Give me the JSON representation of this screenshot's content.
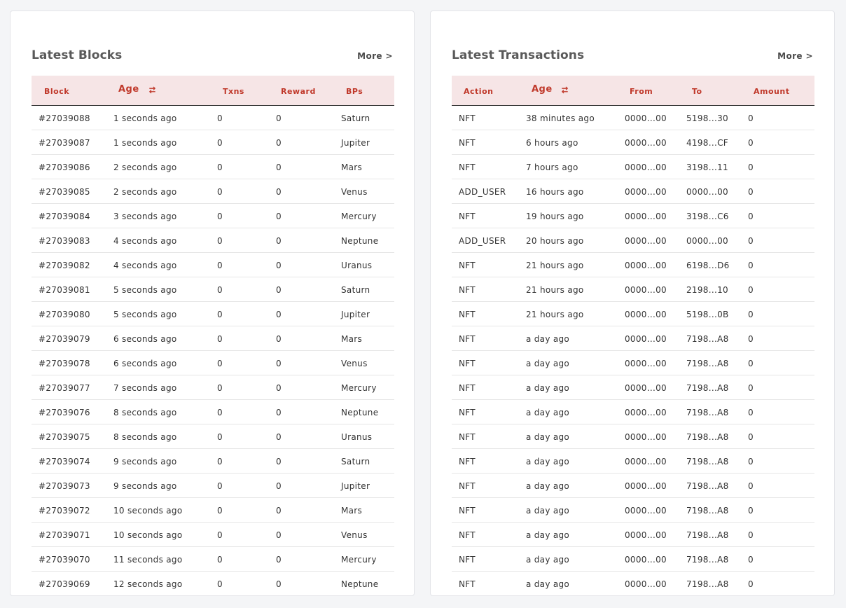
{
  "blocks": {
    "title": "Latest Blocks",
    "more": "More >",
    "columns": [
      "Block",
      "Age",
      "Txns",
      "Reward",
      "BPs"
    ],
    "rows": [
      [
        "#27039088",
        "1 seconds ago",
        "0",
        "0",
        "Saturn"
      ],
      [
        "#27039087",
        "1 seconds ago",
        "0",
        "0",
        "Jupiter"
      ],
      [
        "#27039086",
        "2 seconds ago",
        "0",
        "0",
        "Mars"
      ],
      [
        "#27039085",
        "2 seconds ago",
        "0",
        "0",
        "Venus"
      ],
      [
        "#27039084",
        "3 seconds ago",
        "0",
        "0",
        "Mercury"
      ],
      [
        "#27039083",
        "4 seconds ago",
        "0",
        "0",
        "Neptune"
      ],
      [
        "#27039082",
        "4 seconds ago",
        "0",
        "0",
        "Uranus"
      ],
      [
        "#27039081",
        "5 seconds ago",
        "0",
        "0",
        "Saturn"
      ],
      [
        "#27039080",
        "5 seconds ago",
        "0",
        "0",
        "Jupiter"
      ],
      [
        "#27039079",
        "6 seconds ago",
        "0",
        "0",
        "Mars"
      ],
      [
        "#27039078",
        "6 seconds ago",
        "0",
        "0",
        "Venus"
      ],
      [
        "#27039077",
        "7 seconds ago",
        "0",
        "0",
        "Mercury"
      ],
      [
        "#27039076",
        "8 seconds ago",
        "0",
        "0",
        "Neptune"
      ],
      [
        "#27039075",
        "8 seconds ago",
        "0",
        "0",
        "Uranus"
      ],
      [
        "#27039074",
        "9 seconds ago",
        "0",
        "0",
        "Saturn"
      ],
      [
        "#27039073",
        "9 seconds ago",
        "0",
        "0",
        "Jupiter"
      ],
      [
        "#27039072",
        "10 seconds ago",
        "0",
        "0",
        "Mars"
      ],
      [
        "#27039071",
        "10 seconds ago",
        "0",
        "0",
        "Venus"
      ],
      [
        "#27039070",
        "11 seconds ago",
        "0",
        "0",
        "Mercury"
      ],
      [
        "#27039069",
        "12 seconds ago",
        "0",
        "0",
        "Neptune"
      ]
    ]
  },
  "transactions": {
    "title": "Latest Transactions",
    "more": "More >",
    "columns": [
      "Action",
      "Age",
      "From",
      "To",
      "Amount"
    ],
    "rows": [
      [
        "NFT",
        "38 minutes ago",
        "0000...00",
        "5198...30",
        "0"
      ],
      [
        "NFT",
        "6 hours ago",
        "0000...00",
        "4198...CF",
        "0"
      ],
      [
        "NFT",
        "7 hours ago",
        "0000...00",
        "3198...11",
        "0"
      ],
      [
        "ADD_USER",
        "16 hours ago",
        "0000...00",
        "0000...00",
        "0"
      ],
      [
        "NFT",
        "19 hours ago",
        "0000...00",
        "3198...C6",
        "0"
      ],
      [
        "ADD_USER",
        "20 hours ago",
        "0000...00",
        "0000...00",
        "0"
      ],
      [
        "NFT",
        "21 hours ago",
        "0000...00",
        "6198...D6",
        "0"
      ],
      [
        "NFT",
        "21 hours ago",
        "0000...00",
        "2198...10",
        "0"
      ],
      [
        "NFT",
        "21 hours ago",
        "0000...00",
        "5198...0B",
        "0"
      ],
      [
        "NFT",
        "a day ago",
        "0000...00",
        "7198...A8",
        "0"
      ],
      [
        "NFT",
        "a day ago",
        "0000...00",
        "7198...A8",
        "0"
      ],
      [
        "NFT",
        "a day ago",
        "0000...00",
        "7198...A8",
        "0"
      ],
      [
        "NFT",
        "a day ago",
        "0000...00",
        "7198...A8",
        "0"
      ],
      [
        "NFT",
        "a day ago",
        "0000...00",
        "7198...A8",
        "0"
      ],
      [
        "NFT",
        "a day ago",
        "0000...00",
        "7198...A8",
        "0"
      ],
      [
        "NFT",
        "a day ago",
        "0000...00",
        "7198...A8",
        "0"
      ],
      [
        "NFT",
        "a day ago",
        "0000...00",
        "7198...A8",
        "0"
      ],
      [
        "NFT",
        "a day ago",
        "0000...00",
        "7198...A8",
        "0"
      ],
      [
        "NFT",
        "a day ago",
        "0000...00",
        "7198...A8",
        "0"
      ],
      [
        "NFT",
        "a day ago",
        "0000...00",
        "7198...A8",
        "0"
      ]
    ]
  },
  "icons": {
    "sort": "swap-arrows-icon"
  },
  "colors": {
    "header_bg": "#f6e5e6",
    "header_text": "#c0392b",
    "title": "#5a5a5a"
  }
}
